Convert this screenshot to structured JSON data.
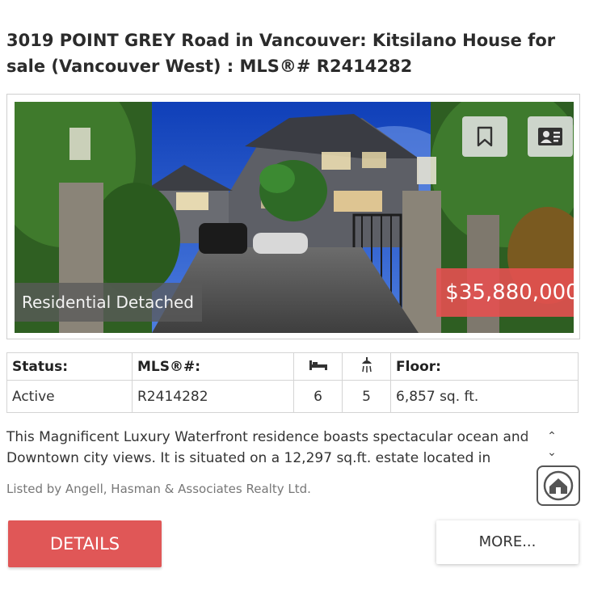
{
  "listing": {
    "title": "3019 POINT GREY Road in Vancouver: Kitsilano House for sale (Vancouver West) : MLS®# R2414282",
    "property_type": "Residential Detached",
    "price": "$35,880,000",
    "photo_icons": [
      "bookmark-icon",
      "contact-card-icon"
    ],
    "facts": {
      "headers": {
        "status": "Status:",
        "mls": "MLS®#:",
        "beds_icon": "bed-icon",
        "baths_icon": "shower-icon",
        "floor": "Floor:"
      },
      "values": {
        "status": "Active",
        "mls": "R2414282",
        "beds": "6",
        "baths": "5",
        "floor": "6,857 sq. ft."
      }
    },
    "description": "This Magnificent Luxury Waterfront residence boasts spectacular ocean and Downtown city views. It is situated on a 12,297 sq.ft. estate located in",
    "listed_by": "Listed by Angell, Hasman & Associates Realty Ltd.",
    "buttons": {
      "details": "DETAILS",
      "more": "MORE..."
    }
  },
  "colors": {
    "accent": "#e05757",
    "price_badge": "#e45050",
    "type_badge": "#5a5a5a"
  }
}
